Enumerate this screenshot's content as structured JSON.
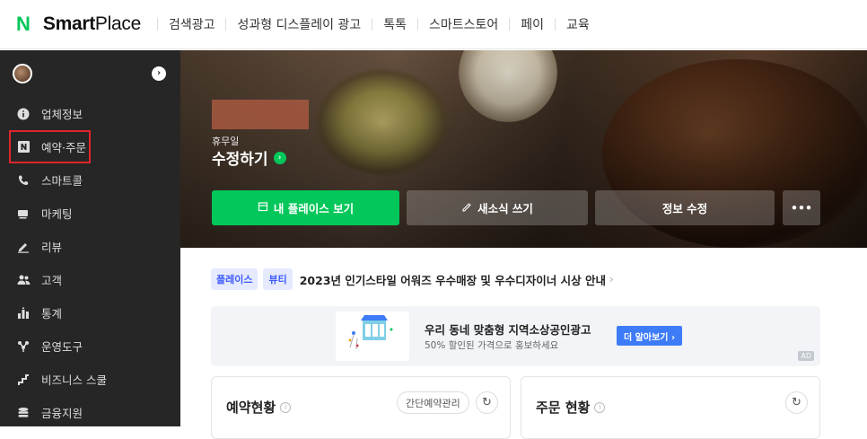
{
  "header": {
    "logo_mark": "N",
    "brand_bold": "Smart",
    "brand_rest": "Place",
    "nav": [
      "검색광고",
      "성과형 디스플레이 광고",
      "톡톡",
      "스마트스토어",
      "페이",
      "교육"
    ]
  },
  "sidebar": {
    "toggle_glyph": "›",
    "items": [
      {
        "label": "업체정보",
        "icon": "info-icon"
      },
      {
        "label": "예약·주문",
        "icon": "naver-n-icon",
        "highlighted": true
      },
      {
        "label": "스마트콜",
        "icon": "phone-icon"
      },
      {
        "label": "마케팅",
        "icon": "megaphone-icon"
      },
      {
        "label": "리뷰",
        "icon": "pencil-icon"
      },
      {
        "label": "고객",
        "icon": "users-icon"
      },
      {
        "label": "통계",
        "icon": "bar-chart-icon"
      },
      {
        "label": "운영도구",
        "icon": "tools-icon"
      },
      {
        "label": "비즈니스 스쿨",
        "icon": "stairs-icon"
      },
      {
        "label": "금융지원",
        "icon": "coins-icon"
      }
    ]
  },
  "hero": {
    "holiday_label": "휴무일",
    "edit_label": "수정하기",
    "buttons": {
      "view_place": "내 플레이스 보기",
      "write_news": "새소식 쓰기",
      "edit_info": "정보 수정",
      "more": "•••"
    }
  },
  "promo": {
    "tags": [
      "플레이스",
      "뷰티"
    ],
    "text": "2023년 인기스타일 어워즈 우수매장 및 우수디자이너 시상 안내",
    "arrow": "›"
  },
  "ad": {
    "title": "우리 동네 맞춤형 지역소상공인광고",
    "subtitle": "50% 할인된 가격으로 홍보하세요",
    "button": "더 알아보기 ›",
    "badge": "AD"
  },
  "cards": {
    "reservation": {
      "title": "예약현황",
      "chip": "간단예약관리"
    },
    "orders": {
      "title": "주문 현황"
    }
  },
  "colors": {
    "accent_green": "#03c75a",
    "sidebar_bg": "#262626",
    "highlight_red": "#e0262c",
    "tag_blue": "#3d5afe",
    "ad_button_blue": "#3e7cf7"
  }
}
